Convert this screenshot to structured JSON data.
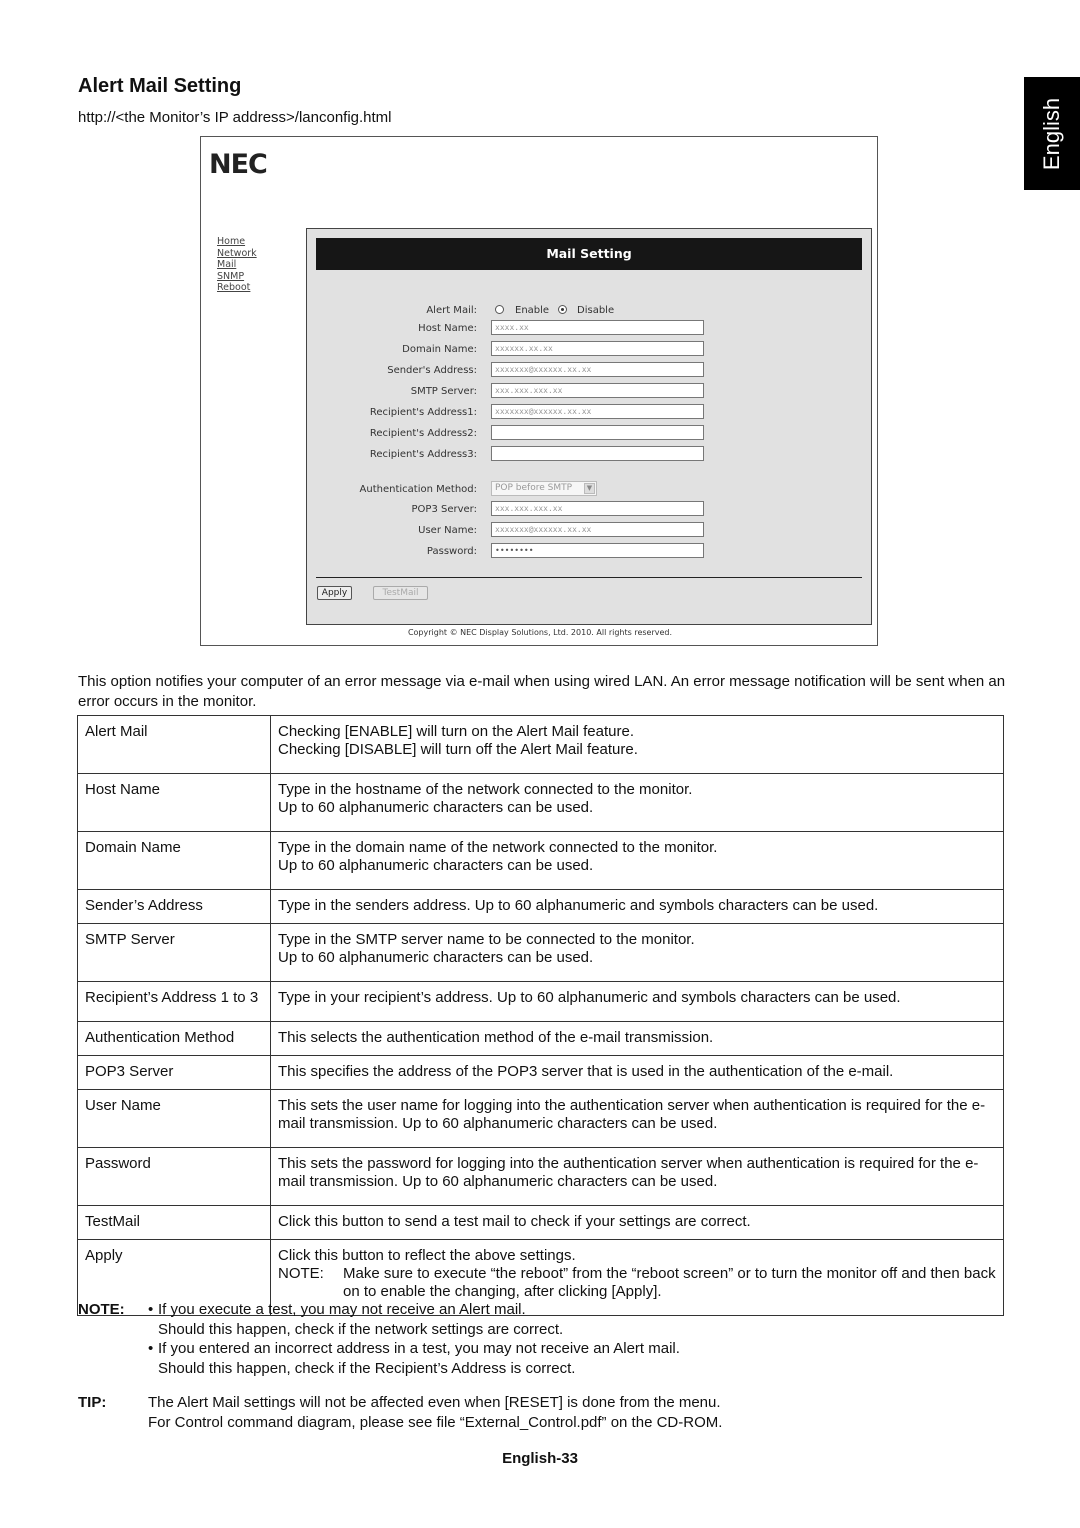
{
  "page": {
    "title": "Alert Mail Setting",
    "url": "http://<the Monitor’s IP address>/lanconfig.html",
    "language_tab": "English",
    "page_number": "English-33"
  },
  "screenshot": {
    "logo": "NEC",
    "nav": [
      "Home",
      "Network",
      "Mail",
      "SNMP",
      "Reboot"
    ],
    "panel_title": "Mail Setting",
    "alert_mail": {
      "label": "Alert Mail:",
      "options": [
        "Enable",
        "Disable"
      ],
      "selected": "Disable"
    },
    "fields": [
      {
        "label": "Host Name:",
        "value": "xxxx.xx"
      },
      {
        "label": "Domain Name:",
        "value": "xxxxxx.xx.xx"
      },
      {
        "label": "Sender's Address:",
        "value": "xxxxxxx@xxxxxx.xx.xx"
      },
      {
        "label": "SMTP Server:",
        "value": "xxx.xxx.xxx.xx"
      },
      {
        "label": "Recipient's Address1:",
        "value": "xxxxxxx@xxxxxx.xx.xx"
      },
      {
        "label": "Recipient's Address2:",
        "value": ""
      },
      {
        "label": "Recipient's Address3:",
        "value": ""
      }
    ],
    "auth": {
      "label": "Authentication Method:",
      "selected": "POP before SMTP"
    },
    "auth_fields": [
      {
        "label": "POP3 Server:",
        "value": "xxx.xxx.xxx.xx"
      },
      {
        "label": "User Name:",
        "value": "xxxxxxx@xxxxxx.xx.xx"
      },
      {
        "label": "Password:",
        "value": "••••••••"
      }
    ],
    "apply_label": "Apply",
    "testmail_label": "TestMail",
    "copyright": "Copyright © NEC Display Solutions, Ltd. 2010. All rights reserved."
  },
  "description": "This option notifies your computer of an error message via e-mail when using wired LAN. An error message notification will be sent when an error occurs in the monitor.",
  "table": [
    {
      "name": "Alert Mail",
      "lines": [
        "Checking [ENABLE] will turn on the Alert Mail feature.",
        "Checking [DISABLE] will turn off the Alert Mail feature."
      ]
    },
    {
      "name": "Host Name",
      "lines": [
        "Type in the hostname of the network connected to the monitor.",
        "Up to 60 alphanumeric characters can be used."
      ]
    },
    {
      "name": "Domain Name",
      "lines": [
        "Type in the domain name of the network connected to the monitor.",
        "Up to 60 alphanumeric characters can be used."
      ]
    },
    {
      "name": "Sender’s Address",
      "lines": [
        "Type in the senders address. Up to 60 alphanumeric and symbols characters can be used."
      ]
    },
    {
      "name": "SMTP Server",
      "lines": [
        "Type in the SMTP server name to be connected to the monitor.",
        "Up to 60 alphanumeric characters can be used."
      ]
    },
    {
      "name": "Recipient’s Address 1 to 3",
      "lines": [
        "Type in your recipient’s address. Up to 60 alphanumeric and symbols characters can be used."
      ]
    },
    {
      "name": "Authentication Method",
      "lines": [
        "This selects the authentication method of the e-mail transmission."
      ]
    },
    {
      "name": "POP3 Server",
      "lines": [
        "This specifies the address of the POP3 server that is used in the authentication of the e-mail."
      ]
    },
    {
      "name": "User Name",
      "lines": [
        "This sets the user name for logging into the authentication server when authentication is required for the e-mail transmission. Up to 60 alphanumeric characters can be used."
      ]
    },
    {
      "name": "Password",
      "lines": [
        "This sets the password for logging into the authentication server when authentication is required for the e-mail transmission. Up to 60 alphanumeric characters can be used."
      ]
    },
    {
      "name": "TestMail",
      "lines": [
        "Click this button to send a test mail to check if your settings are correct."
      ]
    },
    {
      "name": "Apply",
      "lines": [
        "Click this button to reflect the above settings."
      ],
      "note_label": "NOTE:",
      "note": "Make sure to execute “the reboot” from the “reboot screen” or to turn the monitor off and then back on to enable the changing, after clicking [Apply]."
    }
  ],
  "notes": {
    "label": "NOTE:",
    "items": [
      [
        "If you execute a test, you may not receive an Alert mail.",
        "Should this happen, check if the network settings are correct."
      ],
      [
        "If you entered an incorrect address in a test, you may not receive an Alert mail.",
        "Should this happen, check if the Recipient’s Address is correct."
      ]
    ]
  },
  "tip": {
    "label": "TIP:",
    "lines": [
      "The Alert Mail settings will not be affected even when [RESET] is done from the menu.",
      "For Control command diagram, please see file “External_Control.pdf” on the CD-ROM."
    ]
  }
}
